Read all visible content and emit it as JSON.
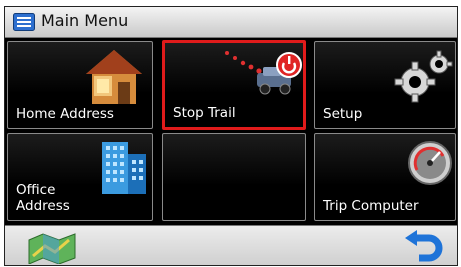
{
  "header": {
    "title": "Main Menu",
    "icon": "menu-icon"
  },
  "tiles": [
    {
      "label": "Home Address",
      "icon": "house-icon"
    },
    {
      "label": "Stop Trail",
      "icon": "stop-trail-icon",
      "selected": true
    },
    {
      "label": "Setup",
      "icon": "gears-icon"
    },
    {
      "label_line1": "Office",
      "label_line2": "Address",
      "icon": "office-building-icon"
    },
    {
      "label": "",
      "icon": ""
    },
    {
      "label": "Trip Computer",
      "icon": "speedometer-icon"
    }
  ],
  "bottom_bar": {
    "left_icon": "map-icon",
    "right_icon": "back-arrow-icon"
  },
  "colors": {
    "selection": "#e01b1b",
    "accent": "#1e73d8"
  }
}
